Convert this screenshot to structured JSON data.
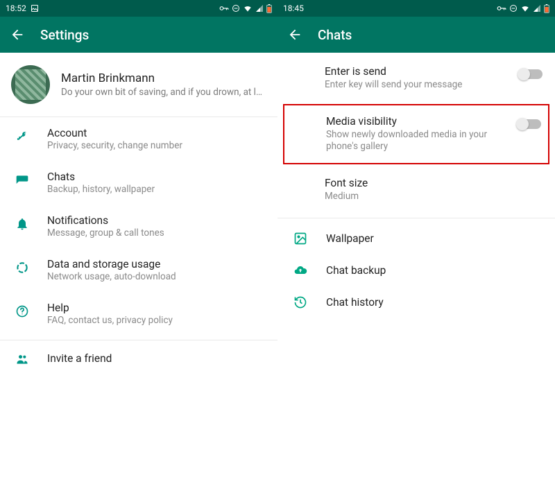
{
  "left": {
    "statusbar": {
      "time": "18:52"
    },
    "appbar": {
      "title": "Settings"
    },
    "profile": {
      "name": "Martin Brinkmann",
      "subtitle": "Do your own bit of saving, and if you drown, at le…"
    },
    "items": [
      {
        "title": "Account",
        "subtitle": "Privacy, security, change number"
      },
      {
        "title": "Chats",
        "subtitle": "Backup, history, wallpaper"
      },
      {
        "title": "Notifications",
        "subtitle": "Message, group & call tones"
      },
      {
        "title": "Data and storage usage",
        "subtitle": "Network usage, auto-download"
      },
      {
        "title": "Help",
        "subtitle": "FAQ, contact us, privacy policy"
      },
      {
        "title": "Invite a friend"
      }
    ]
  },
  "right": {
    "statusbar": {
      "time": "18:45"
    },
    "appbar": {
      "title": "Chats"
    },
    "settings": [
      {
        "title": "Enter is send",
        "subtitle": "Enter key will send your message"
      },
      {
        "title": "Media visibility",
        "subtitle": "Show newly downloaded media in your phone's gallery"
      },
      {
        "title": "Font size",
        "subtitle": "Medium"
      }
    ],
    "iconRows": [
      {
        "title": "Wallpaper"
      },
      {
        "title": "Chat backup"
      },
      {
        "title": "Chat history"
      }
    ]
  }
}
